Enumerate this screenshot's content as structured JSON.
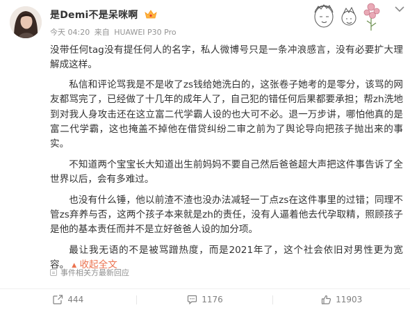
{
  "post": {
    "author": "是Demi不是呆咪啊",
    "time": "今天 04:20",
    "source_prefix": "来自",
    "source": "HUAWEI P30 Pro",
    "paragraphs": [
      "没带任何tag没有提任何人的名字，私人微博号只是一条冲浪感言，没有必要扩大理解成这样。",
      "私信和评论骂我是不是收了zs钱给她洗白的，这张卷子她考的是零分，该骂的网友都骂完了，已经做了十几年的成年人了，自己犯的错任何后果都要承担；帮zh洗地到对我人身攻击还在这立富二代学霸人设的也大可不必。退一万步讲，哪怕他真的是富二代学霸，这也掩盖不掉他在借贷纠纷二审之前为了舆论导向把孩子抛出来的事实。",
      "不知道两个宝宝长大知道出生前妈妈不要自己然后爸爸超大声把这件事告诉了全世界以后，会有多难过。",
      "也没有什么锤，他以前渣不渣也没办法减轻一丁点zs在这件事里的过错；同理不管zs弃养与否，这两个孩子本来就是zh的责任，没有人逼着他去代孕取精，照顾孩子是他的基本责任而并不是立好爸爸人设的加分项。",
      "最让我无语的不是被骂蹭热度，而是2021年了，这个社会依旧对男性更为宽容。"
    ],
    "collapse_label": "收起全文",
    "related": "事件相关方最新回应"
  },
  "actions": {
    "repost_count": "444",
    "comment_count": "1176",
    "like_count": "11903"
  },
  "colors": {
    "link": "#eb7350",
    "meta": "#939393",
    "text": "#333333"
  },
  "icons": [
    "avatar",
    "vip-crown-icon",
    "sketch-decoration",
    "chevron-down-icon",
    "related-event-icon",
    "repost-icon",
    "comment-icon",
    "like-icon"
  ]
}
